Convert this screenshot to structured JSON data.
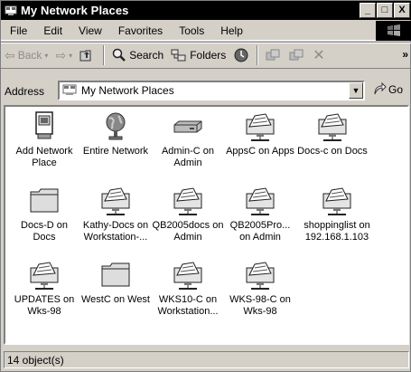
{
  "window": {
    "title": "My Network Places",
    "minimize_label": "_",
    "maximize_label": "□",
    "close_label": "X"
  },
  "menu": {
    "items": [
      "File",
      "Edit",
      "View",
      "Favorites",
      "Tools",
      "Help"
    ]
  },
  "toolbar": {
    "back_label": "Back",
    "search_label": "Search",
    "folders_label": "Folders",
    "more_label": "»"
  },
  "address": {
    "label": "Address",
    "value": "My Network Places",
    "go_label": "Go"
  },
  "items": [
    {
      "label": "Add Network Place",
      "icon": "add-network-place-icon"
    },
    {
      "label": "Entire Network",
      "icon": "globe-icon"
    },
    {
      "label": "Admin-C on Admin",
      "icon": "drive-icon"
    },
    {
      "label": "AppsC on Apps",
      "icon": "network-folder-icon"
    },
    {
      "label": "Docs-c on Docs",
      "icon": "network-folder-icon"
    },
    {
      "label": "Docs-D on Docs",
      "icon": "folder-icon"
    },
    {
      "label": "Kathy-Docs on Workstation-...",
      "icon": "network-folder-icon"
    },
    {
      "label": "QB2005docs on Admin",
      "icon": "network-folder-icon"
    },
    {
      "label": "QB2005Pro... on Admin",
      "icon": "network-folder-icon"
    },
    {
      "label": "shoppinglist on 192.168.1.103",
      "icon": "network-folder-icon"
    },
    {
      "label": "UPDATES on Wks-98",
      "icon": "network-folder-icon"
    },
    {
      "label": "WestC on West",
      "icon": "folder-icon"
    },
    {
      "label": "WKS10-C on Workstation...",
      "icon": "network-folder-icon"
    },
    {
      "label": "WKS-98-C on Wks-98",
      "icon": "network-folder-icon"
    }
  ],
  "status": {
    "text": "14 object(s)"
  }
}
